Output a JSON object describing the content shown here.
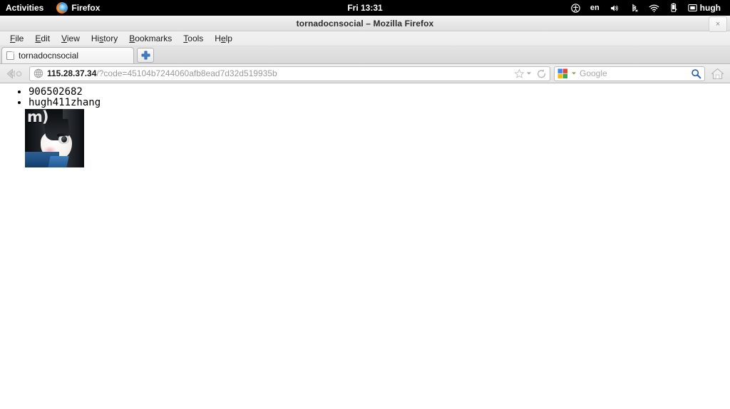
{
  "desktop": {
    "activities_label": "Activities",
    "app_menu_label": "Firefox",
    "app_menu_icon": "firefox-logo-icon",
    "clock": "Fri 13:31",
    "tray": [
      {
        "name": "accessibility-icon",
        "label": ""
      },
      {
        "name": "keyboard-layout-indicator",
        "label": "en"
      },
      {
        "name": "volume-icon",
        "label": ""
      },
      {
        "name": "bluetooth-disabled-icon",
        "label": ""
      },
      {
        "name": "wifi-icon",
        "label": ""
      },
      {
        "name": "battery-icon",
        "label": ""
      },
      {
        "name": "user-menu-icon",
        "label": "hugh"
      }
    ],
    "username": "hugh"
  },
  "window": {
    "title": "tornadocnsocial – Mozilla Firefox",
    "close_label": "×"
  },
  "menubar": {
    "items": [
      {
        "pre": "",
        "mnemonic": "F",
        "post": "ile"
      },
      {
        "pre": "",
        "mnemonic": "E",
        "post": "dit"
      },
      {
        "pre": "",
        "mnemonic": "V",
        "post": "iew"
      },
      {
        "pre": "Hi",
        "mnemonic": "s",
        "post": "tory"
      },
      {
        "pre": "",
        "mnemonic": "B",
        "post": "ookmarks"
      },
      {
        "pre": "",
        "mnemonic": "T",
        "post": "ools"
      },
      {
        "pre": "H",
        "mnemonic": "e",
        "post": "lp"
      }
    ]
  },
  "tabs": {
    "active_tab_title": "tornadocnsocial",
    "new_tab_label": "+"
  },
  "navbar": {
    "back_icon": "back-arrow-icon",
    "forward_icon": "forward-arrow-icon",
    "url_host": "115.28.37.34",
    "url_path": "/?code=45104b7244060afb8ead7d32d519935b",
    "url_full": "115.28.37.34/?code=45104b7244060afb8ead7d32d519935b",
    "site_icon": "globe-icon",
    "bookmark_icon": "star-icon",
    "bookmark_dropdown_icon": "chevron-down-icon",
    "reload_icon": "reload-icon",
    "search_engine": "Google",
    "search_engine_icon": "google-logo-icon",
    "search_placeholder": "Google",
    "search_go_icon": "magnifier-icon",
    "home_icon": "home-icon"
  },
  "page": {
    "list_items": [
      "906502682",
      "hugh411zhang"
    ],
    "avatar": {
      "name": "user-avatar-image",
      "watermark": "m)"
    }
  },
  "colors": {
    "topbar_bg": "#000000",
    "topbar_fg": "#ffffff",
    "chrome_bg": "#e8e8e8",
    "page_bg": "#ffffff",
    "text": "#000000",
    "url_dim": "#9a9a9a",
    "accent_blue": "#3c7fc4"
  }
}
